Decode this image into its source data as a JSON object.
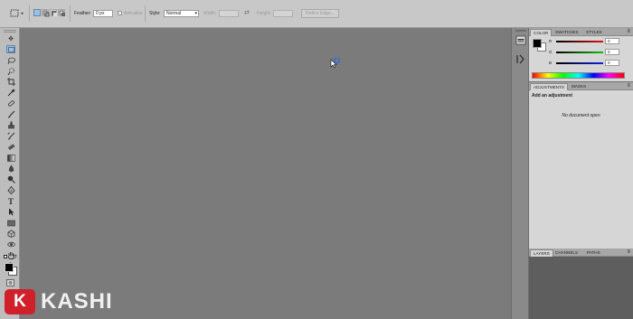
{
  "options_bar": {
    "feather_label": "Feather:",
    "feather_value": "0 px",
    "anti_alias_label": "Anti-alias",
    "style_label": "Style:",
    "style_value": "Normal",
    "width_label": "Width:",
    "height_label": "Height:",
    "refine_edge_label": "Refine Edge..."
  },
  "tools": [
    "move-tool",
    "marquee-tool",
    "lasso-tool",
    "quick-selection-tool",
    "crop-tool",
    "eyedropper-tool",
    "spot-healing-tool",
    "brush-tool",
    "clone-stamp-tool",
    "history-brush-tool",
    "eraser-tool",
    "gradient-tool",
    "blur-tool",
    "dodge-tool",
    "pen-tool",
    "type-tool",
    "path-selection-tool",
    "rectangle-tool",
    "3d-rotate-tool",
    "3d-orbit-tool",
    "hand-tool",
    "zoom-tool"
  ],
  "color_panel": {
    "tabs": [
      "COLOR",
      "SWATCHES",
      "STYLES"
    ],
    "channels": [
      {
        "name": "R",
        "value": "0"
      },
      {
        "name": "G",
        "value": "0"
      },
      {
        "name": "B",
        "value": "0"
      }
    ]
  },
  "adjustments_panel": {
    "tabs": [
      "ADJUSTMENTS",
      "MASKS"
    ],
    "heading": "Add an adjustment",
    "empty_message": "No document open"
  },
  "layers_panel": {
    "tabs": [
      "LAYERS",
      "CHANNELS",
      "PATHS"
    ]
  },
  "watermark": {
    "letter": "K",
    "text": "KASHI"
  }
}
